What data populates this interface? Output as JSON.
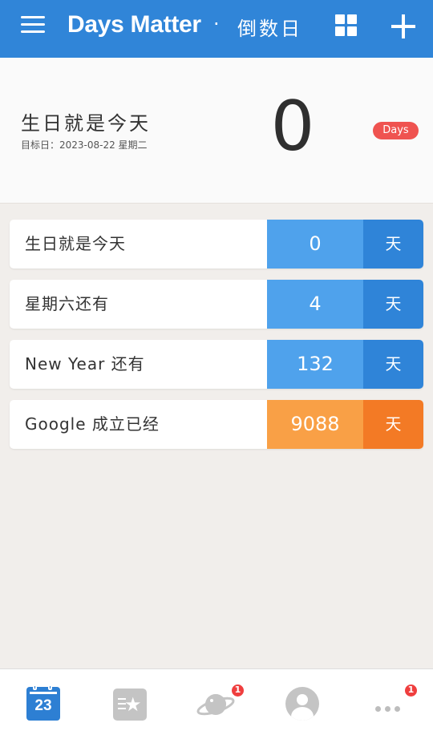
{
  "header": {
    "title": "Days Matter",
    "separator": "·",
    "subtitle": "倒数日"
  },
  "hero": {
    "event_title": "生日就是今天",
    "target_date": "目标日：2023-08-22 星期二",
    "days_value": "0",
    "days_badge": "Days",
    "badge_color": "#ef5350"
  },
  "events": [
    {
      "name": "生日就是今天",
      "days": "0",
      "unit": "天",
      "color": "blue"
    },
    {
      "name": "星期六还有",
      "days": "4",
      "unit": "天",
      "color": "blue"
    },
    {
      "name": "New Year 还有",
      "days": "132",
      "unit": "天",
      "color": "blue"
    },
    {
      "name": "Google 成立已经",
      "days": "9088",
      "unit": "天",
      "color": "orange"
    }
  ],
  "colors": {
    "header_bg": "#3085d8",
    "future_num_bg": "#4fa2ec",
    "future_unit_bg": "#2f84d8",
    "past_num_bg": "#f9a046",
    "past_unit_bg": "#f37a25"
  },
  "bottom_nav": {
    "calendar_day": "23",
    "discover_badge": "1",
    "more_badge": "1",
    "icons": [
      "calendar-icon",
      "favorites-icon",
      "planet-icon",
      "avatar-icon",
      "more-icon"
    ]
  }
}
